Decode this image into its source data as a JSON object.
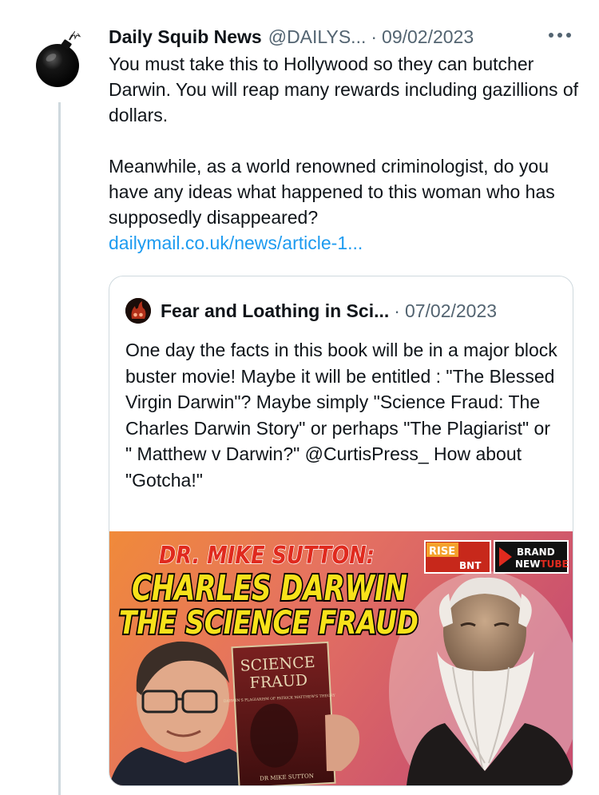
{
  "tweet": {
    "author_name": "Daily Squib News",
    "author_handle": "@DAILYS...",
    "separator": "·",
    "date": "09/02/2023",
    "more_icon": "more-dots-icon",
    "avatar_icon": "bomb-icon",
    "body_lines": [
      "You must take this to Hollywood so they can butcher Darwin. You will reap many rewards including gazillions of dollars.",
      "Meanwhile, as a world renowned criminologist, do you have any ideas what happened to this woman who has supposedly disappeared?"
    ],
    "link_text": "dailymail.co.uk/news/article-1..."
  },
  "quote": {
    "author_name": "Fear and Loathing in Sci...",
    "separator": "·",
    "date": "07/02/2023",
    "text": "One day the facts in this book will be in a major block buster movie! Maybe it will be entitled : \"The Blessed Virgin Darwin\"? Maybe simply \"Science Fraud: The Charles Darwin Story\" or perhaps \"The Plagiarist\" or \" Matthew v Darwin?\" @CurtisPress_  How about \"Gotcha!\"",
    "media": {
      "headline_line1": "DR. MIKE SUTTON:",
      "headline_line2": "CHARLES DARWIN",
      "headline_line3": "THE SCIENCE FRAUD",
      "badge_rise": "RISE",
      "badge_bnt": "BNT",
      "badge_brand": "BRAND",
      "badge_new": "NEW",
      "badge_tube": "TUBE",
      "book_title_1": "SCIENCE",
      "book_title_2": "FRAUD",
      "book_subtitle": "DARWIN'S PLAGIARISM OF PATRICK MATTHEW'S THEORY",
      "book_author": "DR MIKE SUTTON",
      "colors": {
        "headline_red": "#e02a1e",
        "headline_yellow": "#f7e21a",
        "bg_pink": "#d8606a",
        "bg_orange": "#f08a3a"
      }
    }
  }
}
